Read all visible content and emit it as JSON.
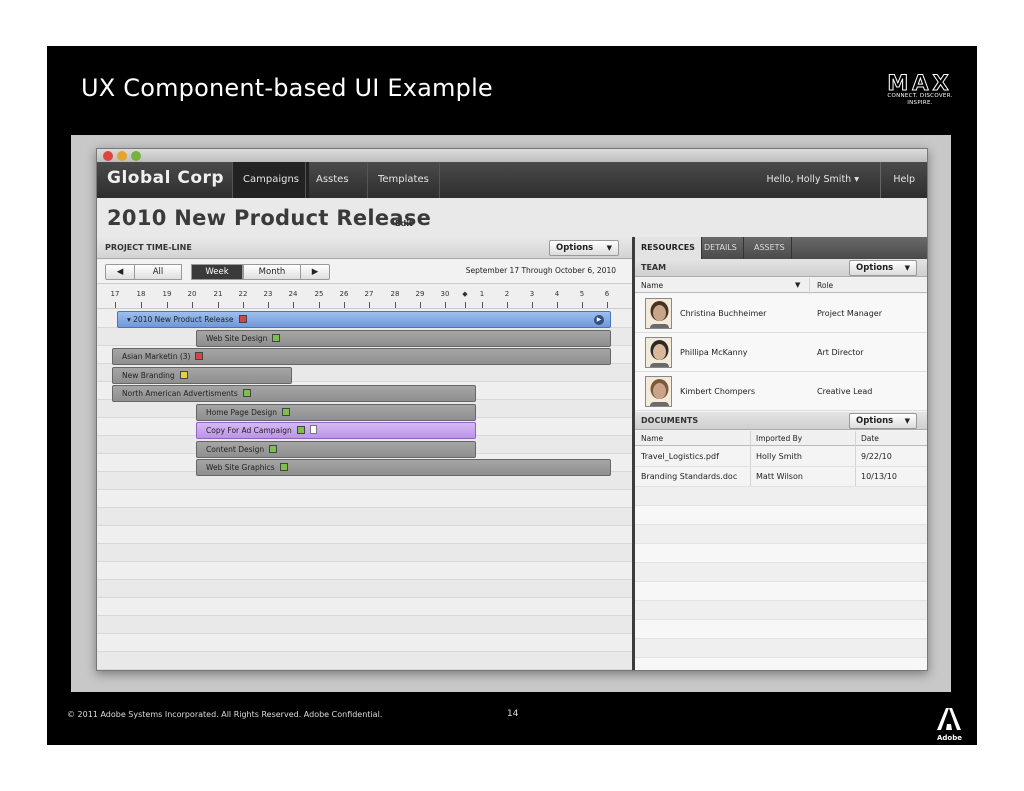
{
  "slide": {
    "title": "UX Component-based UI Example",
    "logo_text": "MAX",
    "logo_tagline": "CONNECT. DISCOVER. INSPIRE.",
    "footer": "© 2011 Adobe Systems Incorporated.  All Rights Reserved.  Adobe Confidential.",
    "page_number": "14",
    "adobe_word": "Adobe"
  },
  "app": {
    "brand": "Global Corp",
    "nav": [
      "Campaigns",
      "Asstes",
      "Templates"
    ],
    "user_menu": "Hello, Holly Smith ▾",
    "help": "Help",
    "page_title": "2010 New Product Release",
    "edit": "Edit"
  },
  "timeline": {
    "header": "PROJECT TIME-LINE",
    "options_label": "Options",
    "controls": {
      "prev": "◀",
      "all": "All",
      "week": "Week",
      "month": "Month",
      "next": "▶"
    },
    "date_range": "September 17 Through October 6, 2010",
    "ticks": [
      "17",
      "18",
      "19",
      "20",
      "21",
      "22",
      "23",
      "24",
      "25",
      "26",
      "27",
      "28",
      "29",
      "30",
      "◆",
      "1",
      "2",
      "3",
      "4",
      "5",
      "6"
    ],
    "tasks": [
      {
        "label": "▾ 2010 New Product Release",
        "status": "red"
      },
      {
        "label": "Web Site Design",
        "status": "green"
      },
      {
        "label": "Asian Marketin (3)",
        "status": "red"
      },
      {
        "label": "New Branding",
        "status": "yellow"
      },
      {
        "label": "North American Advertisments",
        "status": "green"
      },
      {
        "label": "Home Page Design",
        "status": "green"
      },
      {
        "label": "Copy For Ad Campaign",
        "status": "green"
      },
      {
        "label": "Content Design",
        "status": "green"
      },
      {
        "label": "Web Site Graphics",
        "status": "green"
      }
    ]
  },
  "details": {
    "tabs": [
      "RESOURCES",
      "DETAILS",
      "ASSETS"
    ],
    "team_header": "TEAM",
    "team_options": "Options",
    "team_columns": {
      "name": "Name",
      "role": "Role"
    },
    "team": [
      {
        "name": "Christina Buchheimer",
        "role": "Project Manager"
      },
      {
        "name": "Phillipa McKanny",
        "role": "Art Director"
      },
      {
        "name": "Kimbert Chompers",
        "role": "Creative Lead"
      }
    ],
    "documents_header": "DOCUMENTS",
    "documents_options": "Options",
    "doc_columns": {
      "name": "Name",
      "imported_by": "Imported By",
      "date": "Date"
    },
    "documents": [
      {
        "name": "Travel_Logistics.pdf",
        "imported_by": "Holly Smith",
        "date": "9/22/10"
      },
      {
        "name": "Branding Standards.doc",
        "imported_by": "Matt Wilson",
        "date": "10/13/10"
      }
    ]
  },
  "colors": {
    "slide_bg": "#000000",
    "header_bg": "#3a3a3a",
    "summary_bar": "#7ba0e0",
    "task_bar": "#999999",
    "selected_task": "#c9a5f0"
  }
}
